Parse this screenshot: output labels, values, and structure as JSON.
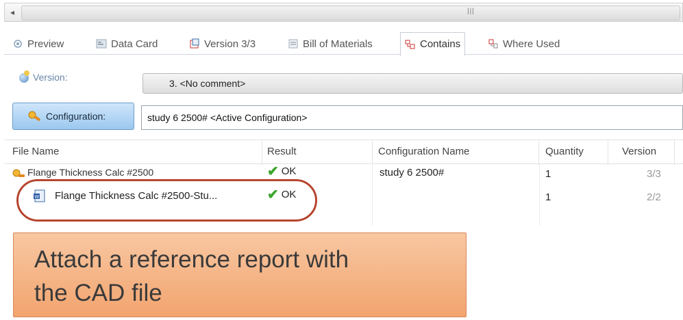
{
  "tabs": [
    {
      "label": "Preview",
      "icon": "preview-icon"
    },
    {
      "label": "Data Card",
      "icon": "data-card-icon"
    },
    {
      "label": "Version 3/3",
      "icon": "version-icon"
    },
    {
      "label": "Bill of Materials",
      "icon": "bom-icon"
    },
    {
      "label": "Contains",
      "icon": "contains-icon",
      "active": true
    },
    {
      "label": "Where Used",
      "icon": "where-used-icon"
    }
  ],
  "version": {
    "label": "Version:",
    "value": "3. <No comment>"
  },
  "configuration": {
    "button_label": "Configuration:",
    "value": "study 6 2500# <Active Configuration>"
  },
  "table": {
    "columns": [
      "File Name",
      "Result",
      "Configuration Name",
      "Quantity",
      "Version"
    ],
    "rows": [
      {
        "file_name": "Flange Thickness Calc #2500",
        "result": "OK",
        "configuration_name": "study 6 2500#",
        "quantity": "1",
        "version": "3/3"
      },
      {
        "file_name": "Flange Thickness Calc #2500-Stu...",
        "result": "OK",
        "configuration_name": "",
        "quantity": "1",
        "version": "2/2"
      }
    ]
  },
  "callout": {
    "line1": "Attach a reference report with",
    "line2": "the CAD file"
  },
  "colors": {
    "highlight": "#b6452f",
    "callout_bg": "#f4b486",
    "ok_check": "#3ca52d",
    "accent_blue": "#9cc8ef"
  }
}
